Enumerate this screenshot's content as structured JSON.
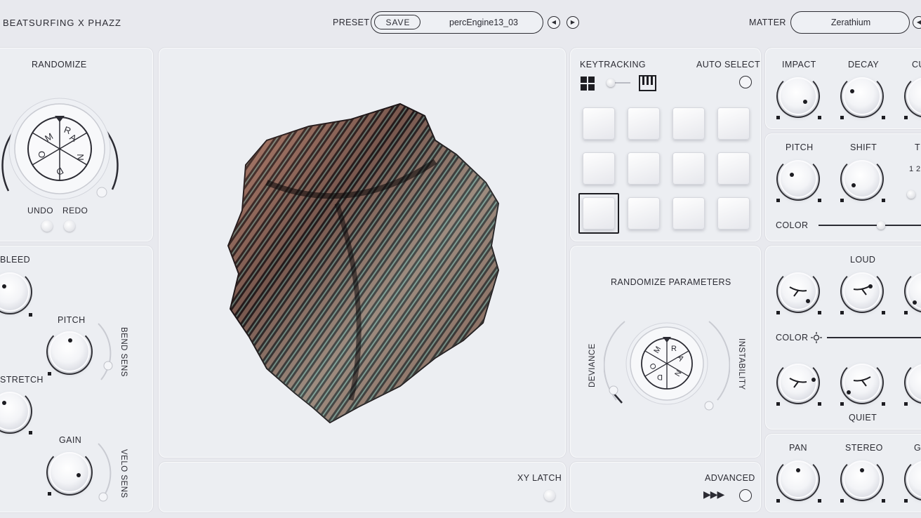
{
  "header": {
    "brand": "BEATSURFING X PHAZZ",
    "preset_label": "PRESET",
    "save_label": "SAVE",
    "preset_name": "percEngine13_03",
    "prev_icon": "triangle-left",
    "next_icon": "triangle-right",
    "matter_label": "MATTER",
    "matter_value": "Zerathium"
  },
  "randomize": {
    "title": "RANDOMIZE",
    "dial_letters": [
      "R",
      "A",
      "N",
      "D",
      "O",
      "M"
    ],
    "undo_label": "UNDO",
    "redo_label": "REDO"
  },
  "left_params": {
    "bleed_label": "BLEED",
    "pitch_label": "PITCH",
    "bend_sens_label": "BEND SENS",
    "stretch_label": "STRETCH",
    "gain_label": "GAIN",
    "velo_sens_label": "VELO SENS"
  },
  "visual": {
    "xy_latch_label": "XY LATCH"
  },
  "keytracking": {
    "title": "KEYTRACKING",
    "auto_select_label": "AUTO SELECT",
    "grid_icon": "grid-icon",
    "piano_icon": "piano-icon",
    "pad_count": 12,
    "selected_pad": 9
  },
  "randomize_params": {
    "title": "RANDOMIZE PARAMETERS",
    "deviance_label": "DEVIANCE",
    "instability_label": "INSTABILITY",
    "dial_letters": [
      "R",
      "A",
      "N",
      "D",
      "O",
      "M"
    ]
  },
  "advanced": {
    "label": "ADVANCED",
    "arrows": "▶▶▶"
  },
  "right_params": {
    "impact_label": "IMPACT",
    "decay_label": "DECAY",
    "cut_label": "CU",
    "pitch_label": "PITCH",
    "shift_label": "SHIFT",
    "t_label": "T",
    "t_nums": "1 2",
    "color_label": "COLOR",
    "color_slider": 0.62,
    "loud_label": "LOUD",
    "color2_label": "COLOR",
    "quiet_label": "QUIET",
    "pan_label": "PAN",
    "stereo_label": "STEREO",
    "g_label": "G"
  },
  "colors": {
    "background": "#e8e9ee",
    "panel": "#eceef2",
    "ink": "#2b2b33"
  }
}
